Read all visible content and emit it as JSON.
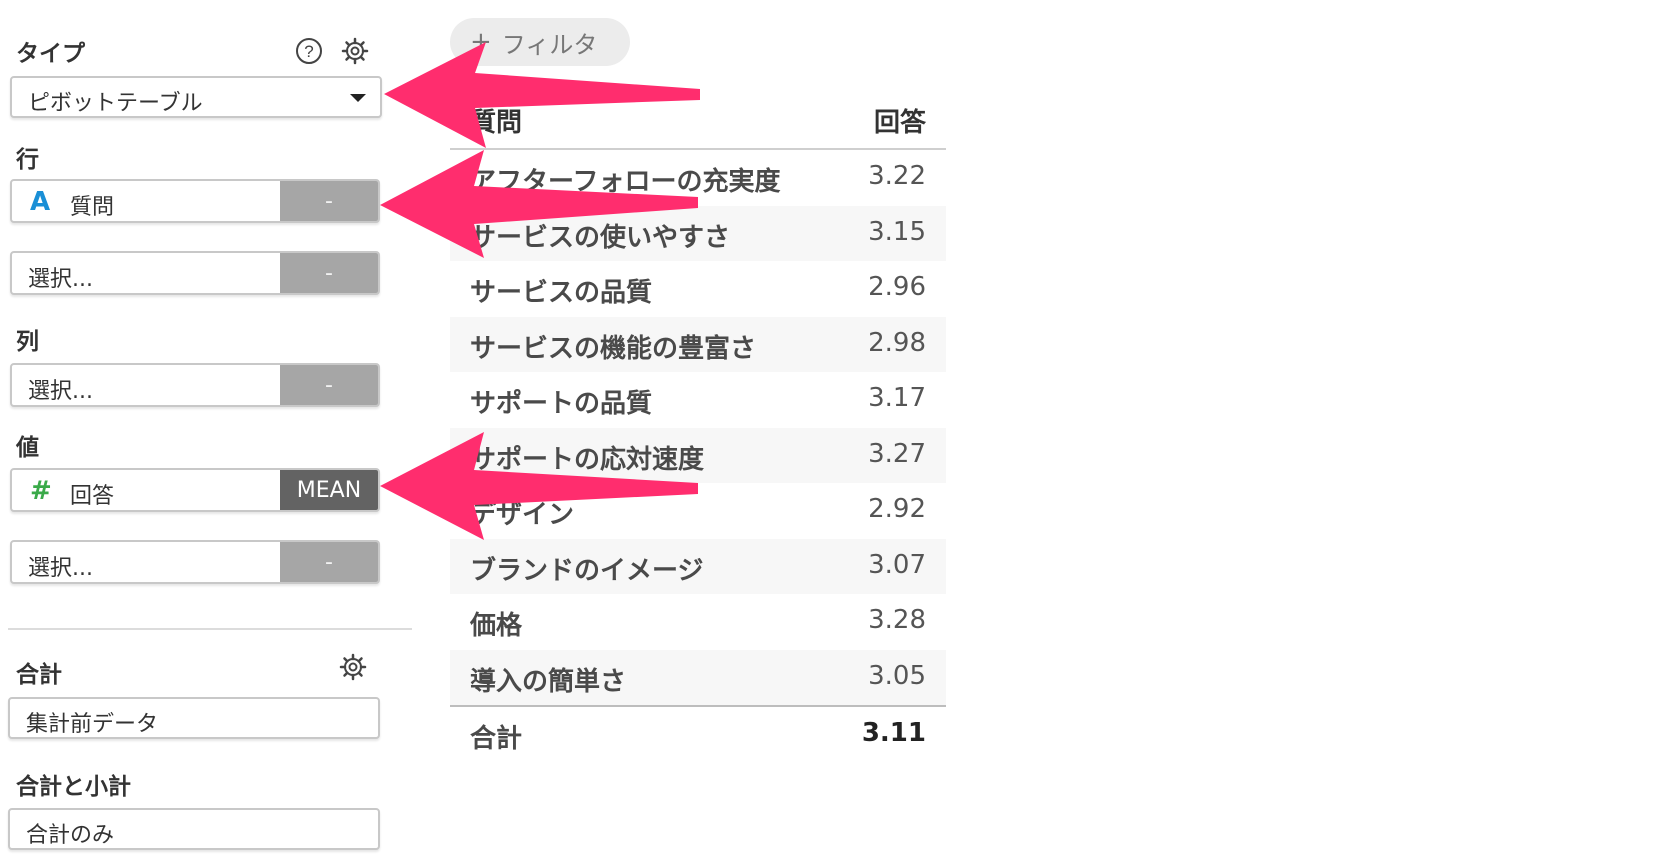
{
  "sidebar": {
    "type_label": "タイプ",
    "type_value": "ピボットテーブル",
    "rows_label": "行",
    "rows": [
      {
        "icon": "text-type-icon",
        "glyph": "A",
        "glyph_color": "#1a8fd6",
        "text": "質問",
        "agg": "-"
      },
      {
        "text": "選択...",
        "agg": "-"
      }
    ],
    "columns_label": "列",
    "columns": [
      {
        "text": "選択...",
        "agg": "-"
      }
    ],
    "values_label": "値",
    "values": [
      {
        "icon": "number-type-icon",
        "glyph": "#",
        "glyph_color": "#3aaa49",
        "text": "回答",
        "agg": "MEAN"
      },
      {
        "text": "選択...",
        "agg": "-"
      }
    ],
    "total_label": "合計",
    "total_value": "集計前データ",
    "subtotal_label": "合計と小計",
    "subtotal_value": "合計のみ"
  },
  "filter": {
    "plus": "+",
    "label": "フィルタ"
  },
  "table": {
    "headers": [
      "質問",
      "回答"
    ],
    "rows": [
      {
        "q": "アフターフォローの充実度",
        "v": "3.22"
      },
      {
        "q": "サービスの使いやすさ",
        "v": "3.15"
      },
      {
        "q": "サービスの品質",
        "v": "2.96"
      },
      {
        "q": "サービスの機能の豊富さ",
        "v": "2.98"
      },
      {
        "q": "サポートの品質",
        "v": "3.17"
      },
      {
        "q": "サポートの応対速度",
        "v": "3.27"
      },
      {
        "q": "デザイン",
        "v": "2.92"
      },
      {
        "q": "ブランドのイメージ",
        "v": "3.07"
      },
      {
        "q": "価格",
        "v": "3.28"
      },
      {
        "q": "導入の簡単さ",
        "v": "3.05"
      }
    ],
    "total_label": "合計",
    "total_value": "3.11"
  },
  "colors": {
    "annotation_arrow": "#ff2d6e",
    "agg_button": "#a6a6a6",
    "agg_button_active": "#636363"
  }
}
